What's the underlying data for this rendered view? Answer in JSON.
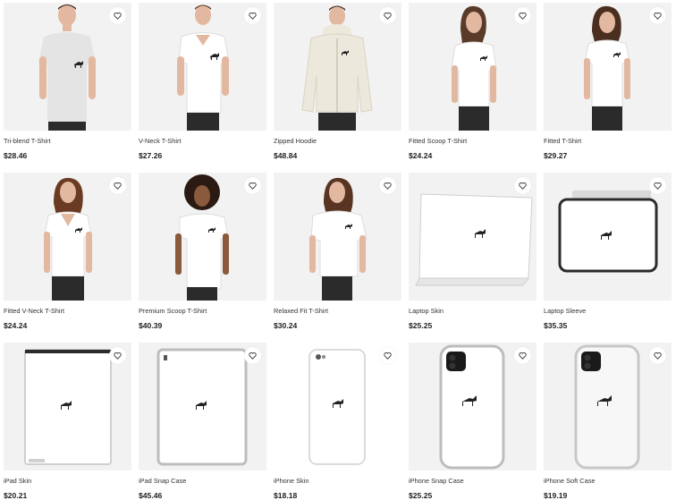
{
  "products": [
    {
      "title": "Tri-blend T-Shirt",
      "price": "$28.46",
      "image": "person-tshirt-heather"
    },
    {
      "title": "V-Neck T-Shirt",
      "price": "$27.26",
      "image": "person-vneck"
    },
    {
      "title": "Zipped Hoodie",
      "price": "$48.84",
      "image": "person-hoodie"
    },
    {
      "title": "Fitted Scoop T-Shirt",
      "price": "$24.24",
      "image": "woman-scoop"
    },
    {
      "title": "Fitted T-Shirt",
      "price": "$29.27",
      "image": "woman-fitted"
    },
    {
      "title": "Fitted V-Neck T-Shirt",
      "price": "$24.24",
      "image": "woman-vneck"
    },
    {
      "title": "Premium Scoop T-Shirt",
      "price": "$40.39",
      "image": "woman-premium-scoop"
    },
    {
      "title": "Relaxed Fit T-Shirt",
      "price": "$30.24",
      "image": "woman-relaxed"
    },
    {
      "title": "Laptop Skin",
      "price": "$25.25",
      "image": "laptop-skin"
    },
    {
      "title": "Laptop Sleeve",
      "price": "$35.35",
      "image": "laptop-sleeve"
    },
    {
      "title": "iPad Skin",
      "price": "$20.21",
      "image": "ipad-skin"
    },
    {
      "title": "iPad Snap Case",
      "price": "$45.46",
      "image": "ipad-snap"
    },
    {
      "title": "iPhone Skin",
      "price": "$18.18",
      "image": "iphone-skin"
    },
    {
      "title": "iPhone Snap Case",
      "price": "$25.25",
      "image": "iphone-snap"
    },
    {
      "title": "iPhone Soft Case",
      "price": "$19.19",
      "image": "iphone-soft"
    }
  ],
  "icons": {
    "favorite": "heart-outline-icon",
    "artwork": "lion-logo-icon"
  },
  "colors": {
    "thumb_bg": "#f2f2f2",
    "shirt": "#ffffff",
    "heather": "#e4e4e4",
    "hoodie": "#ece9dc",
    "pants": "#2b2b2b",
    "skin": "#e2b9a0",
    "hair": "#3b2a20"
  }
}
